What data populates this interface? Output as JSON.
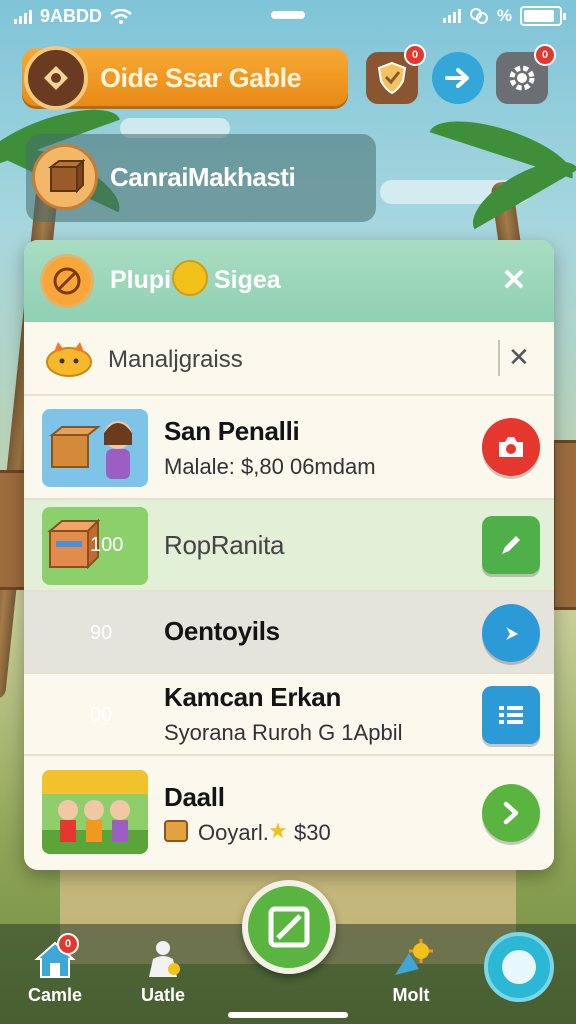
{
  "status_bar": {
    "carrier": "9ABDD",
    "right_text": "%"
  },
  "header": {
    "title": "Oide Ssar Gable",
    "shield_badge": "0",
    "gear_badge": "0"
  },
  "profile": {
    "name": "CanraiMakhasti"
  },
  "panel": {
    "title": "Plupi",
    "subtitle": "Sigea",
    "search_text": "Manaljgraiss",
    "rows": [
      {
        "title": "San Penalli",
        "subtitle": "Malale: $,80  06mdam"
      },
      {
        "count": "100",
        "title": "RopRanita"
      },
      {
        "count": "90",
        "title": "Oentoyils"
      },
      {
        "count": "00",
        "title": "Kamcan Erkan",
        "subtitle": "Syorana Ruroh  G 1Apbil"
      },
      {
        "title": "Daall",
        "subtitle": "Ooyarl.",
        "price": "$30"
      }
    ]
  },
  "bottom_nav": {
    "left_label": "Camle",
    "mid_label": "Uatle",
    "right_label": "Molt",
    "left_badge": "0"
  },
  "colors": {
    "accent_orange": "#f0981f",
    "accent_green": "#5ab540",
    "accent_blue": "#2d9ad8",
    "accent_red": "#e5372d"
  }
}
